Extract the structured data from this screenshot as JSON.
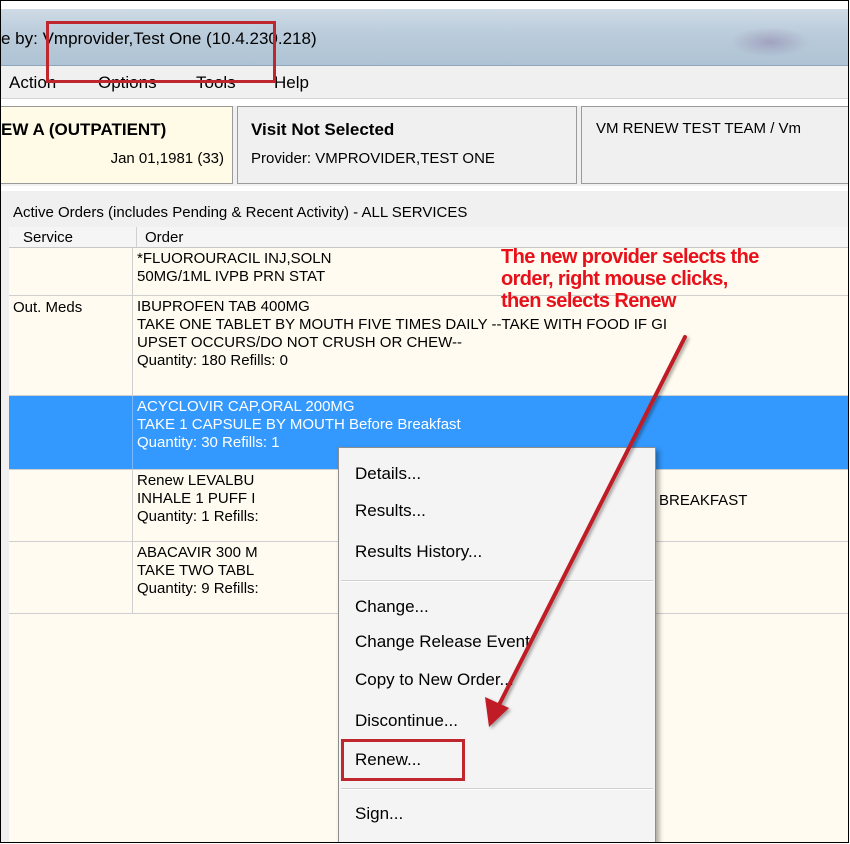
{
  "window": {
    "title": "e by: Vmprovider,Test One  (10.4.230.218)"
  },
  "menu": [
    "Action",
    "Options",
    "Tools",
    "Help"
  ],
  "patient": {
    "name": "EW A (OUTPATIENT)",
    "dob": "Jan 01,1981 (33)"
  },
  "visit": {
    "title": "Visit Not Selected",
    "provider": "Provider:  VMPROVIDER,TEST ONE"
  },
  "team": {
    "text": "VM RENEW TEST TEAM / Vm"
  },
  "orders": {
    "caption": "Active Orders (includes Pending & Recent Activity) - ALL SERVICES",
    "columns": {
      "service": "Service",
      "order": "Order"
    },
    "rows": [
      {
        "service": "",
        "lines": [
          "*FLUOROURACIL INJ,SOLN",
          "50MG/1ML IVPB PRN STAT"
        ]
      },
      {
        "service": "Out. Meds",
        "lines": [
          "IBUPROFEN TAB  400MG",
          "TAKE ONE TABLET BY MOUTH FIVE TIMES DAILY --TAKE WITH FOOD IF GI",
          "UPSET OCCURS/DO NOT CRUSH OR CHEW--",
          "Quantity: 180 Refills: 0"
        ]
      },
      {
        "service": "",
        "lines": [
          "ACYCLOVIR CAP,ORAL  200MG",
          "TAKE 1 CAPSULE BY MOUTH Before Breakfast",
          "Quantity: 30 Refills: 1"
        ],
        "selected": true
      },
      {
        "service": "",
        "lines": [
          "Renew LEVALBU",
          "INHALE 1 PUFF I",
          "Quantity: 1 Refills:"
        ],
        "trailing": "BREAKFAST"
      },
      {
        "service": "",
        "lines": [
          "ABACAVIR 300 M",
          "TAKE TWO TABL",
          "Quantity: 9 Refills:"
        ]
      }
    ]
  },
  "context_menu": {
    "items": [
      "Details...",
      "Results...",
      "Results History...",
      "Change...",
      "Change Release Event",
      "Copy to New Order...",
      "Discontinue...",
      "Renew...",
      "Sign..."
    ]
  },
  "annotation": {
    "lines": [
      "The new provider selects the",
      "order, right mouse clicks,",
      "then selects Renew"
    ],
    "color": "#e8101a"
  },
  "colors": {
    "selection": "#3399ff",
    "highlight_box": "#c0262d",
    "arrow": "#c01f25"
  }
}
